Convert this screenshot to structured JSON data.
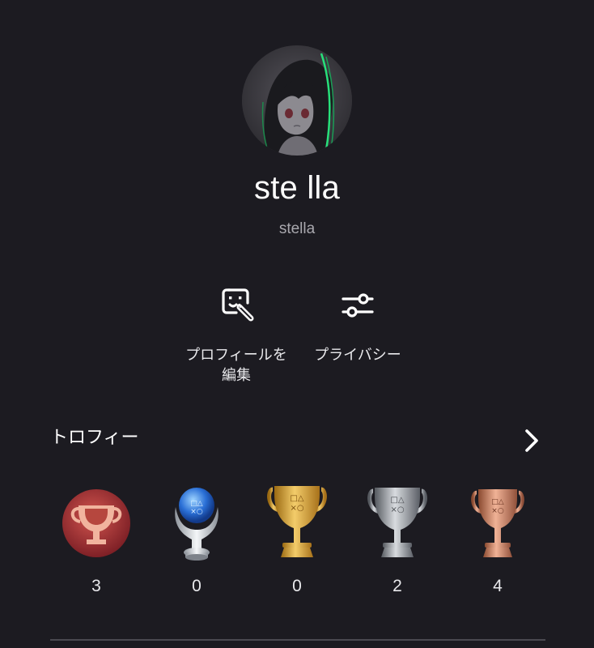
{
  "profile": {
    "display_name": "ste lla",
    "online_id": "stella",
    "avatar_icon": "avatar-image"
  },
  "actions": [
    {
      "label": "プロフィールを\n編集",
      "icon": "edit-profile-icon"
    },
    {
      "label": "プライバシー",
      "icon": "sliders-icon"
    }
  ],
  "trophies": {
    "header": "トロフィー",
    "items": [
      {
        "type": "level",
        "count": "3",
        "icon": "trophy-level-icon"
      },
      {
        "type": "platinum",
        "count": "0",
        "icon": "platinum-trophy-icon"
      },
      {
        "type": "gold",
        "count": "0",
        "icon": "gold-trophy-icon"
      },
      {
        "type": "silver",
        "count": "2",
        "icon": "silver-trophy-icon"
      },
      {
        "type": "bronze",
        "count": "4",
        "icon": "bronze-trophy-icon"
      }
    ]
  },
  "colors": {
    "background": "#1c1b21",
    "secondary_text": "#a9a8ae",
    "divider": "#4a4950"
  }
}
